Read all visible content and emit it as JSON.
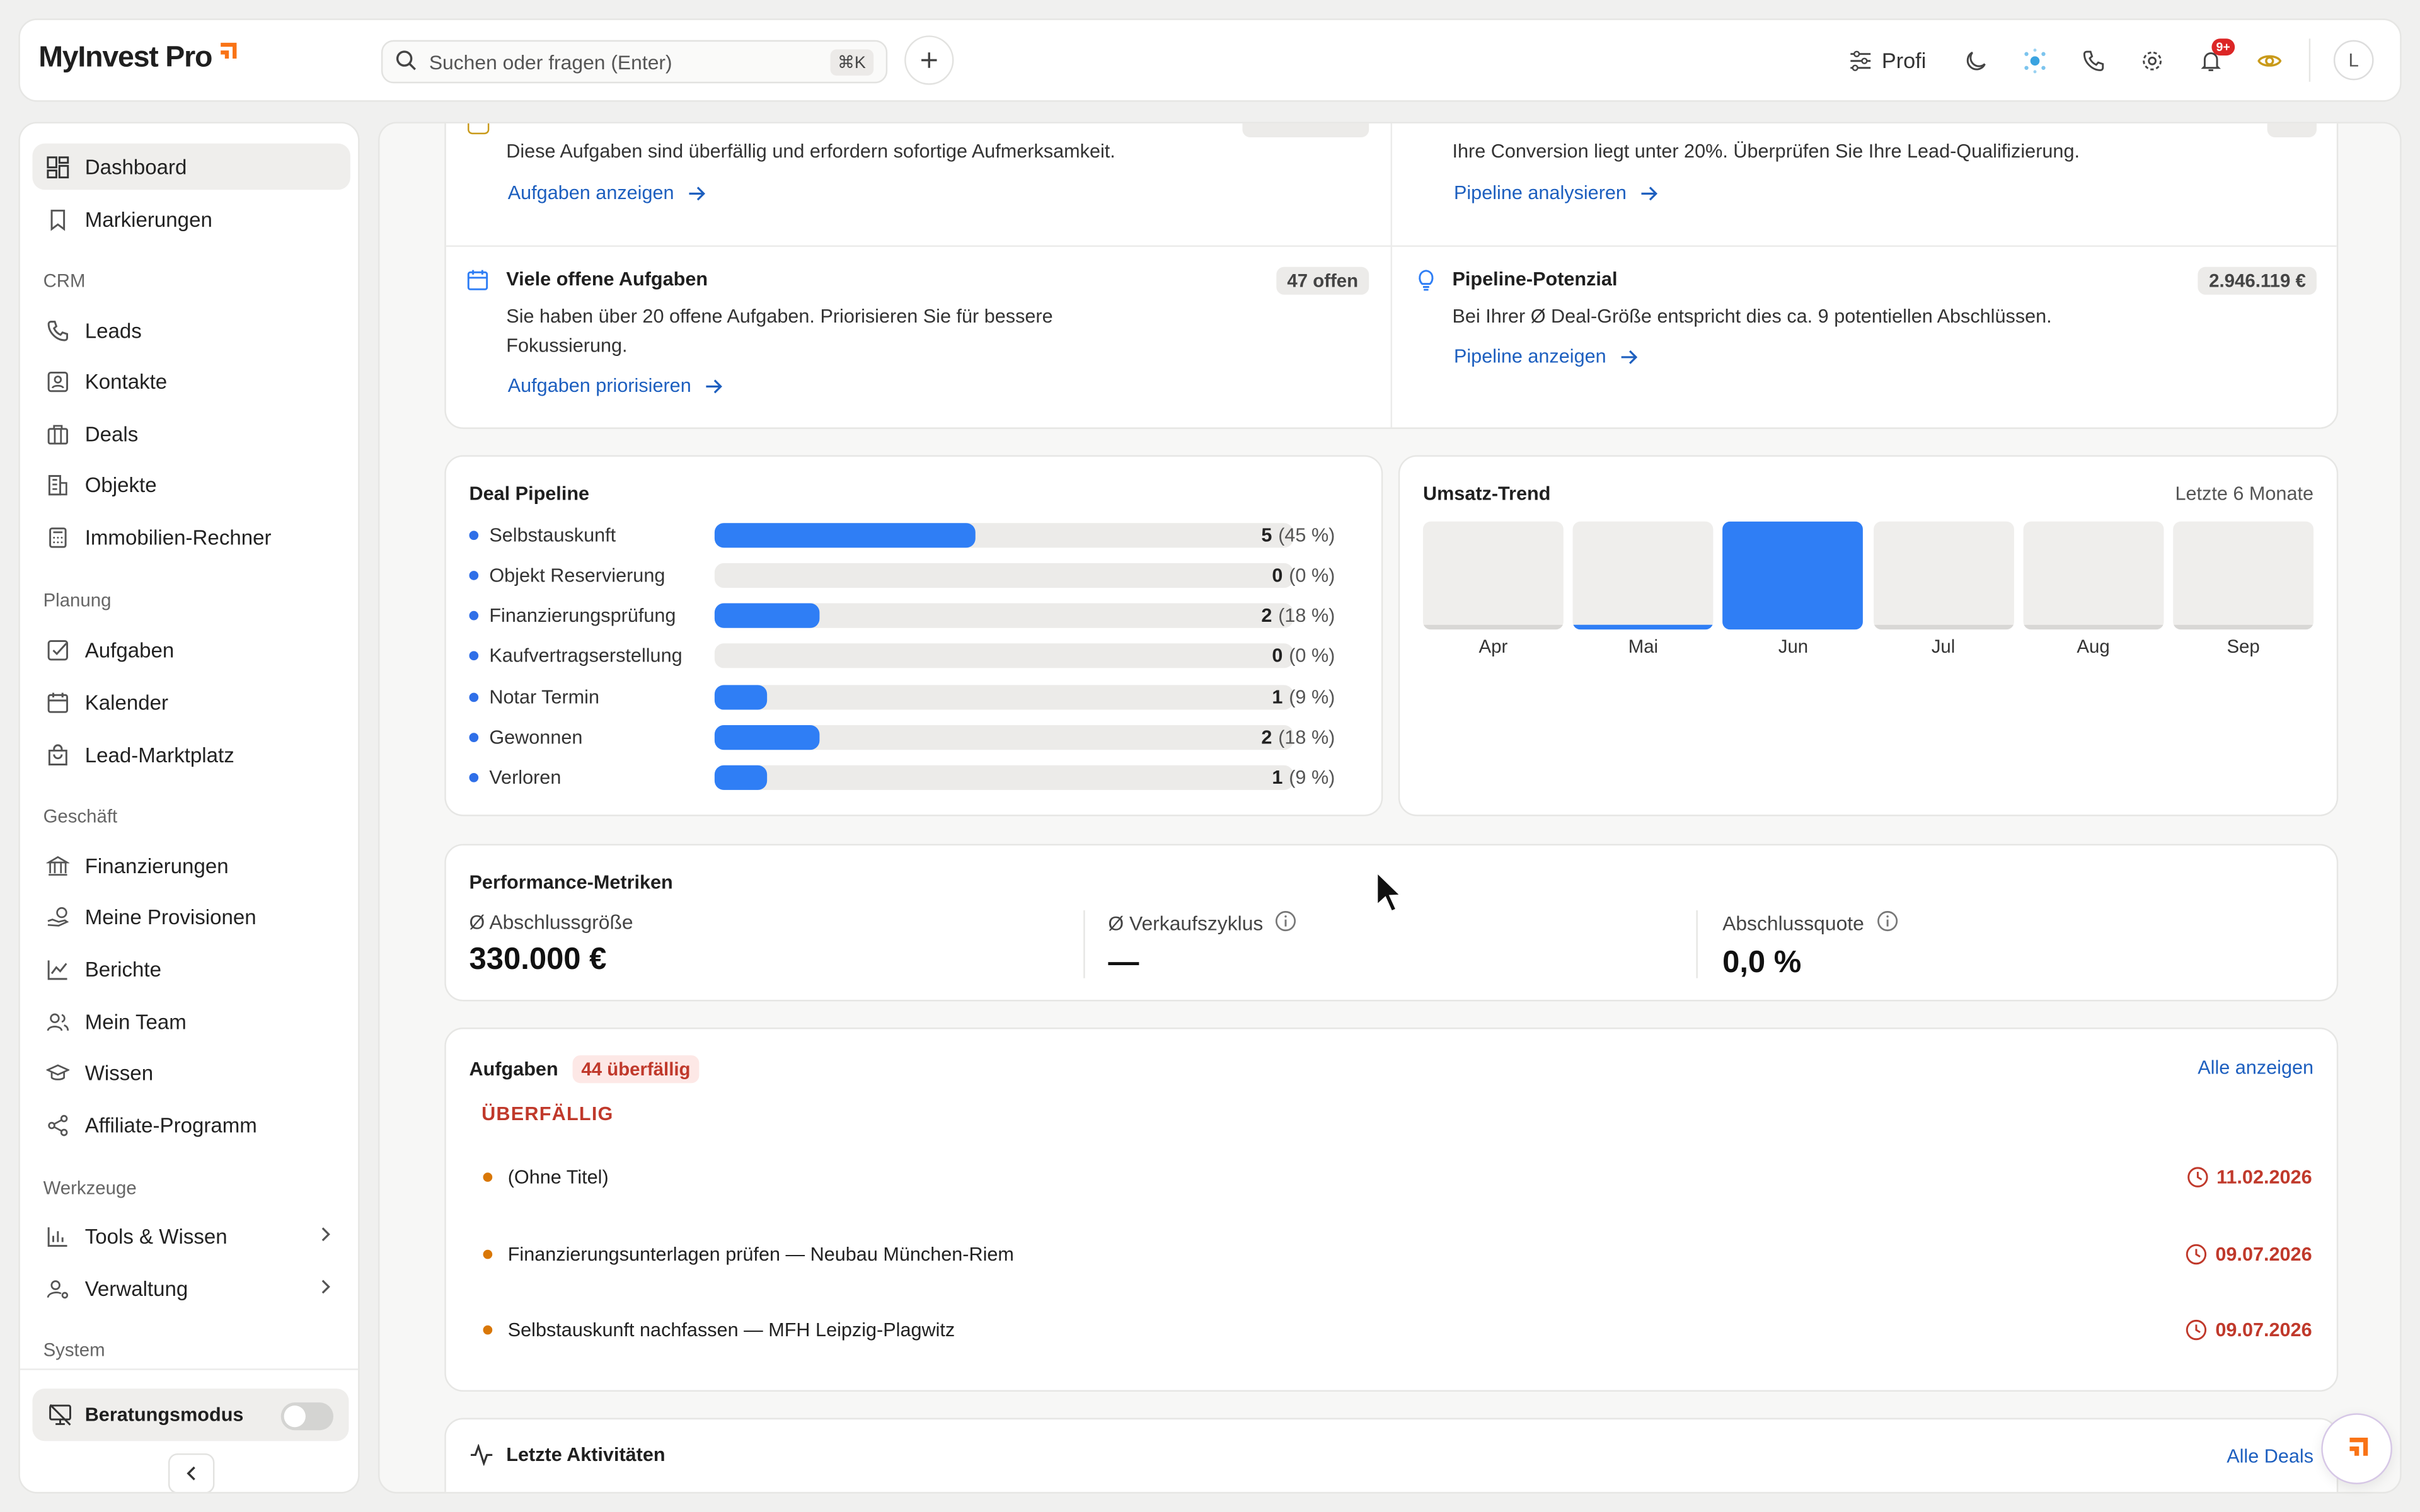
{
  "header": {
    "logo": "MyInvest Pro",
    "search_placeholder": "Suchen oder fragen (Enter)",
    "search_shortcut": "⌘K",
    "profi_label": "Profi",
    "notifications_badge": "9+",
    "avatar_initial": "L"
  },
  "sidebar": {
    "items": {
      "dashboard": "Dashboard",
      "bookmarks": "Markierungen",
      "leads": "Leads",
      "contacts": "Kontakte",
      "deals": "Deals",
      "objects": "Objekte",
      "calculator": "Immobilien-Rechner",
      "tasks": "Aufgaben",
      "calendar": "Kalender",
      "marketplace": "Lead-Marktplatz",
      "financing": "Finanzierungen",
      "commissions": "Meine Provisionen",
      "reports": "Berichte",
      "team": "Mein Team",
      "knowledge": "Wissen",
      "affiliate": "Affiliate-Programm",
      "tools": "Tools & Wissen",
      "admin": "Verwaltung"
    },
    "sections": {
      "crm": "CRM",
      "planning": "Planung",
      "business": "Geschäft",
      "tools": "Werkzeuge",
      "system": "System"
    },
    "consult_mode": "Beratungsmodus"
  },
  "hints": {
    "top_left_desc": "Diese Aufgaben sind überfällig und erfordern sofortige Aufmerksamkeit.",
    "top_left_link": "Aufgaben anzeigen",
    "top_right_desc": "Ihre Conversion liegt unter 20%. Überprüfen Sie Ihre Lead-Qualifizierung.",
    "top_right_link": "Pipeline analysieren",
    "open_tasks_title": "Viele offene Aufgaben",
    "open_tasks_badge": "47 offen",
    "open_tasks_desc_1": "Sie haben über 20 offene Aufgaben. Priorisieren Sie für bessere",
    "open_tasks_desc_2": "Fokussierung.",
    "open_tasks_link": "Aufgaben priorisieren",
    "potential_title": "Pipeline-Potenzial",
    "potential_badge": "2.946.119 €",
    "potential_desc": "Bei Ihrer Ø Deal-Größe entspricht dies ca. 9 potentiellen Abschlüssen.",
    "potential_link": "Pipeline anzeigen"
  },
  "pipeline": {
    "title": "Deal Pipeline",
    "rows": [
      {
        "label": "Selbstauskunft",
        "count": "5",
        "pct": "(45 %)",
        "fraction": 0.45
      },
      {
        "label": "Objekt Reservierung",
        "count": "0",
        "pct": "(0 %)",
        "fraction": 0
      },
      {
        "label": "Finanzierungsprüfung",
        "count": "2",
        "pct": "(18 %)",
        "fraction": 0.18
      },
      {
        "label": "Kaufvertragserstellung",
        "count": "0",
        "pct": "(0 %)",
        "fraction": 0
      },
      {
        "label": "Notar Termin",
        "count": "1",
        "pct": "(9 %)",
        "fraction": 0.09
      },
      {
        "label": "Gewonnen",
        "count": "2",
        "pct": "(18 %)",
        "fraction": 0.18
      },
      {
        "label": "Verloren",
        "count": "1",
        "pct": "(9 %)",
        "fraction": 0.09
      }
    ]
  },
  "trend": {
    "title": "Umsatz-Trend",
    "range": "Letzte 6 Monate",
    "months": [
      {
        "label": "Apr",
        "fraction": 0.0
      },
      {
        "label": "Mai",
        "fraction": 0.05
      },
      {
        "label": "Jun",
        "fraction": 1.0
      },
      {
        "label": "Jul",
        "fraction": 0.0
      },
      {
        "label": "Aug",
        "fraction": 0.0
      },
      {
        "label": "Sep",
        "fraction": 0.0
      }
    ]
  },
  "metrics": {
    "title": "Performance-Metriken",
    "avg_size_label": "Ø Abschlussgröße",
    "avg_size_value": "330.000 €",
    "cycle_label": "Ø Verkaufszyklus",
    "cycle_value": "—",
    "rate_label": "Abschlussquote",
    "rate_value": "0,0 %"
  },
  "tasks": {
    "title": "Aufgaben",
    "overdue_badge": "44 überfällig",
    "show_all": "Alle anzeigen",
    "overdue_heading": "ÜBERFÄLLIG",
    "items": [
      {
        "title": "(Ohne Titel)",
        "date": "11.02.2026"
      },
      {
        "title": "Finanzierungsunterlagen prüfen — Neubau München-Riem",
        "date": "09.07.2026"
      },
      {
        "title": "Selbstauskunft nachfassen — MFH Leipzig-Plagwitz",
        "date": "09.07.2026"
      }
    ]
  },
  "activities": {
    "title": "Letzte Aktivitäten",
    "all_deals": "Alle Deals"
  },
  "colors": {
    "accent_blue": "#2f7ef5",
    "brand_orange": "#f97316",
    "overdue_red": "#c0392b"
  }
}
